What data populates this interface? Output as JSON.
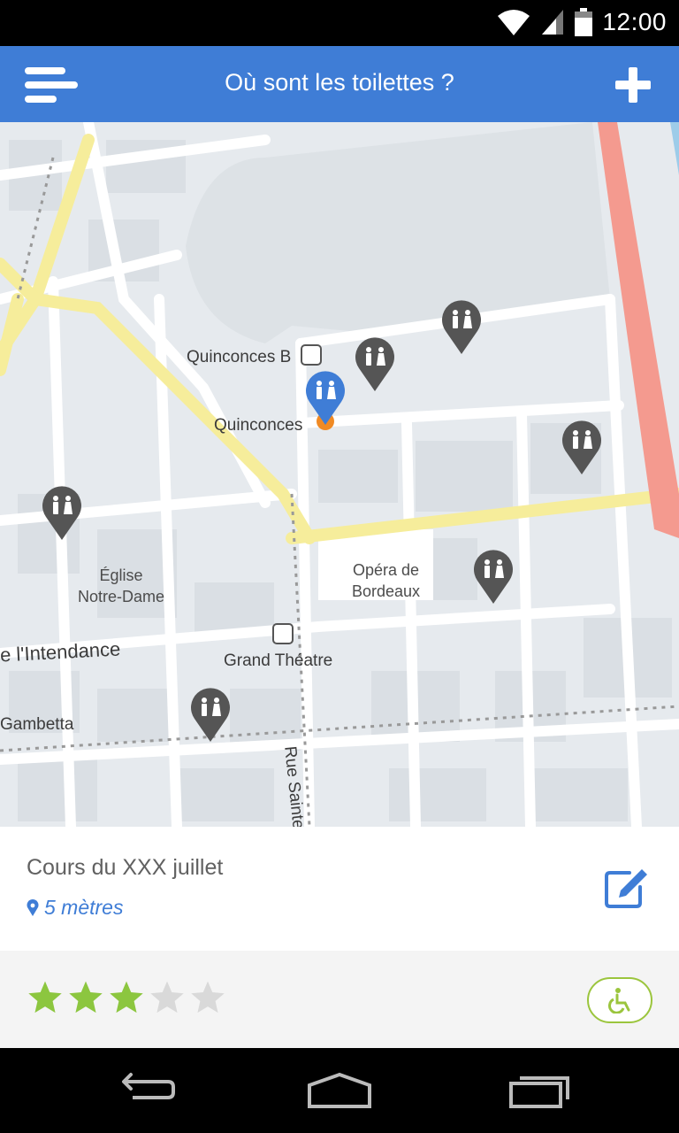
{
  "status_bar": {
    "time": "12:00"
  },
  "app_bar": {
    "title": "Où sont les toilettes ?"
  },
  "map": {
    "labels": {
      "quinconces_b": "Quinconces B",
      "quinconces": "Quinconces",
      "eglise": "Église\nNotre-Dame",
      "opera": "Opéra de\nBordeaux",
      "intendance": "e  l'Intendance",
      "grand_theatre": "Grand Théatre",
      "rue_sainte": "Rue Sainte",
      "gambetta": "Gambetta"
    }
  },
  "info": {
    "address": "Cours du XXX juillet",
    "distance": "5 mètres"
  },
  "rating": {
    "value": 3,
    "max": 5
  },
  "colors": {
    "app_bar": "#3F7DD6",
    "selected_pin": "#3F7DD6",
    "pin": "#555555",
    "star_filled": "#8CC63F",
    "star_empty": "#D9D9D9",
    "accessibility": "#9BC53D"
  }
}
